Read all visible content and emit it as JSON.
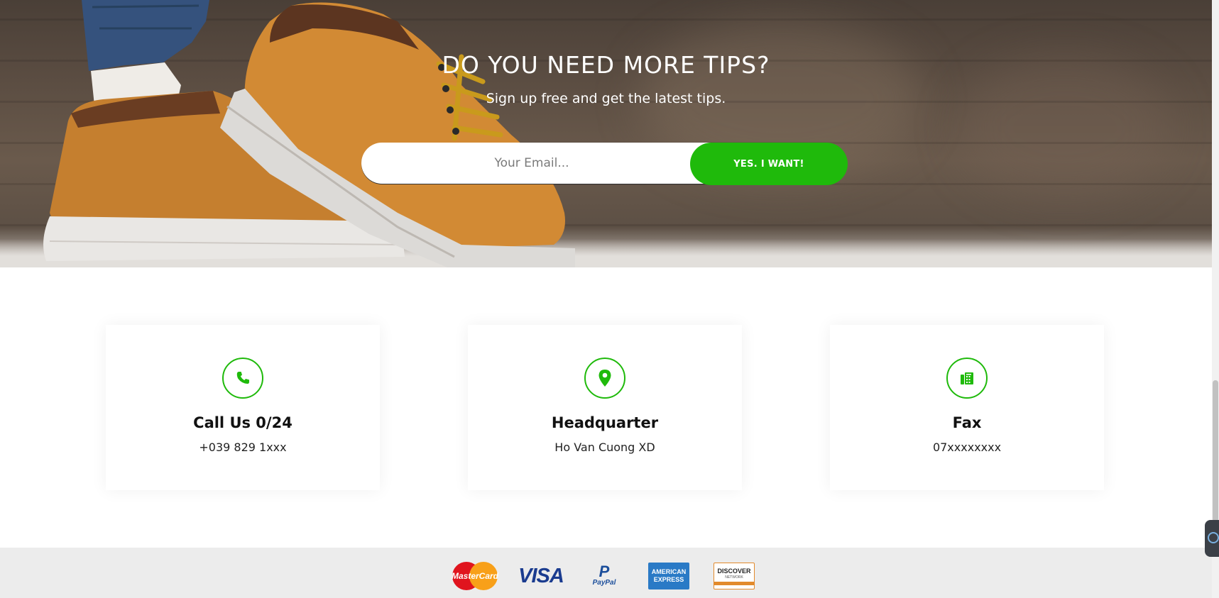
{
  "newsletter": {
    "title": "DO YOU NEED MORE TIPS?",
    "subtitle": "Sign up free and get the latest tips.",
    "email_placeholder": "Your Email...",
    "submit_label": "YES. I WANT!"
  },
  "contacts": [
    {
      "icon": "phone-icon",
      "title": "Call Us 0/24",
      "value": "+039 829 1xxx"
    },
    {
      "icon": "map-pin-icon",
      "title": "Headquarter",
      "value": "Ho Van Cuong XD"
    },
    {
      "icon": "fax-icon",
      "title": "Fax",
      "value": "07xxxxxxxx"
    }
  ],
  "payments": {
    "mastercard": "MasterCard",
    "visa": "VISA",
    "paypal": "PayPal",
    "amex_line1": "AMERICAN",
    "amex_line2": "EXPRESS",
    "discover": "DISCOVER",
    "discover_sub": "NETWORK"
  },
  "colors": {
    "accent": "#1fba0b",
    "footer_bg": "#ececec"
  }
}
